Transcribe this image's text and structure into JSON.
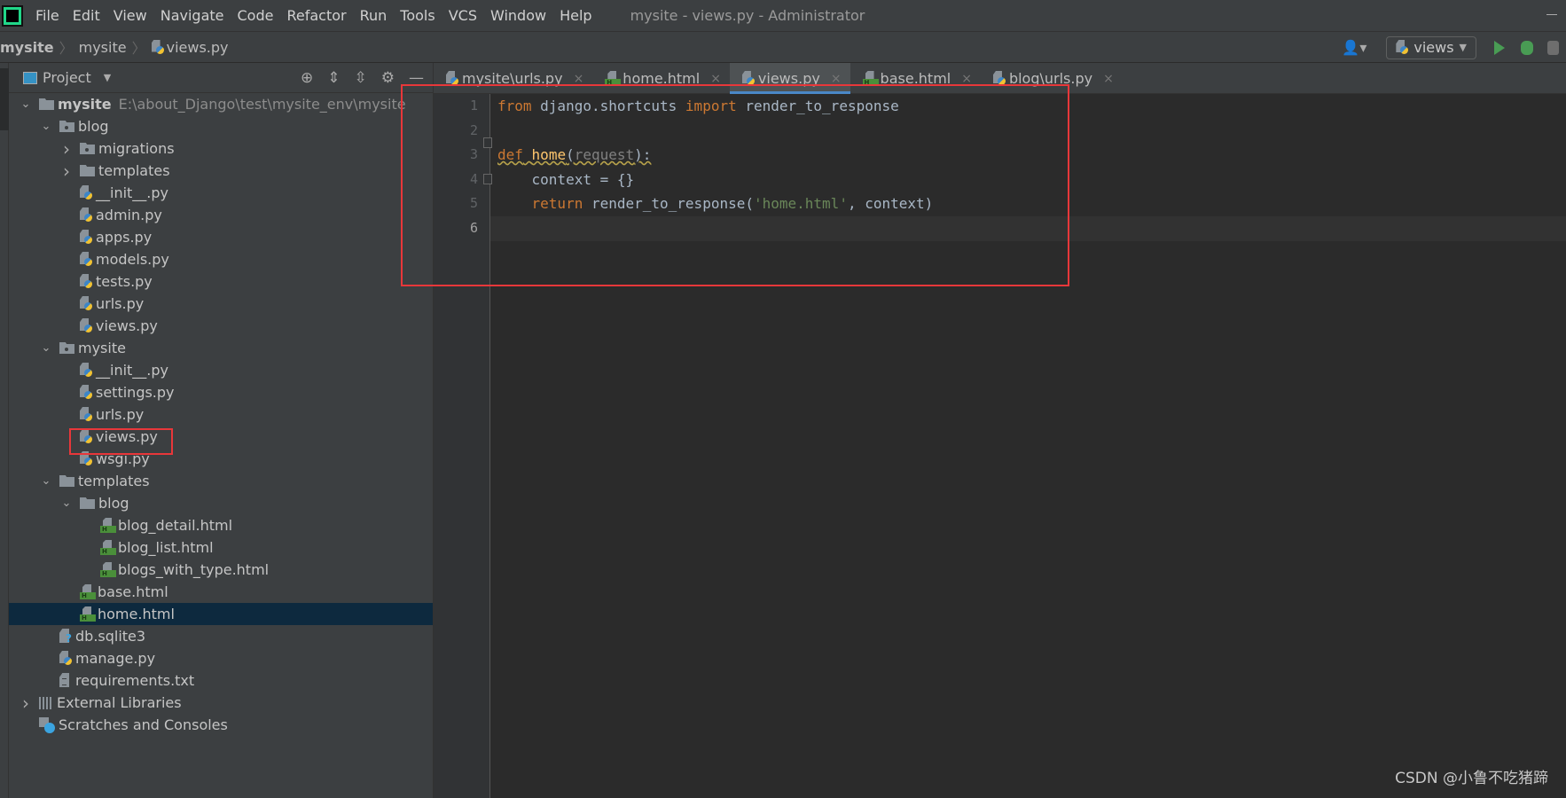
{
  "menubar": {
    "items": [
      "File",
      "Edit",
      "View",
      "Navigate",
      "Code",
      "Refactor",
      "Run",
      "Tools",
      "VCS",
      "Window",
      "Help"
    ],
    "window_title": "mysite - views.py - Administrator"
  },
  "breadcrumb": {
    "items": [
      "mysite",
      "mysite",
      "views.py"
    ]
  },
  "run_config": {
    "label": "views"
  },
  "project_panel": {
    "title": "Project"
  },
  "tree": [
    {
      "label": "mysite",
      "hint": "E:\\about_Django\\test\\mysite_env\\mysite",
      "depth": 0,
      "icon": "folder",
      "arrow": "down",
      "bold": true
    },
    {
      "label": "blog",
      "depth": 1,
      "icon": "folder-module",
      "arrow": "down"
    },
    {
      "label": "migrations",
      "depth": 2,
      "icon": "folder-module",
      "arrow": "right"
    },
    {
      "label": "templates",
      "depth": 2,
      "icon": "folder",
      "arrow": "right"
    },
    {
      "label": "__init__.py",
      "depth": 2,
      "icon": "python-file"
    },
    {
      "label": "admin.py",
      "depth": 2,
      "icon": "python-file"
    },
    {
      "label": "apps.py",
      "depth": 2,
      "icon": "python-file"
    },
    {
      "label": "models.py",
      "depth": 2,
      "icon": "python-file"
    },
    {
      "label": "tests.py",
      "depth": 2,
      "icon": "python-file"
    },
    {
      "label": "urls.py",
      "depth": 2,
      "icon": "python-file"
    },
    {
      "label": "views.py",
      "depth": 2,
      "icon": "python-file"
    },
    {
      "label": "mysite",
      "depth": 1,
      "icon": "folder-module",
      "arrow": "down"
    },
    {
      "label": "__init__.py",
      "depth": 2,
      "icon": "python-file"
    },
    {
      "label": "settings.py",
      "depth": 2,
      "icon": "python-file"
    },
    {
      "label": "urls.py",
      "depth": 2,
      "icon": "python-file"
    },
    {
      "label": "views.py",
      "depth": 2,
      "icon": "python-file",
      "highlighted": true
    },
    {
      "label": "wsgi.py",
      "depth": 2,
      "icon": "python-file"
    },
    {
      "label": "templates",
      "depth": 1,
      "icon": "folder",
      "arrow": "down"
    },
    {
      "label": "blog",
      "depth": 2,
      "icon": "folder",
      "arrow": "down"
    },
    {
      "label": "blog_detail.html",
      "depth": 3,
      "icon": "html-file"
    },
    {
      "label": "blog_list.html",
      "depth": 3,
      "icon": "html-file"
    },
    {
      "label": "blogs_with_type.html",
      "depth": 3,
      "icon": "html-file"
    },
    {
      "label": "base.html",
      "depth": 2,
      "icon": "html-file"
    },
    {
      "label": "home.html",
      "depth": 2,
      "icon": "html-file",
      "selected": true
    },
    {
      "label": "db.sqlite3",
      "depth": 1,
      "icon": "unknown-file"
    },
    {
      "label": "manage.py",
      "depth": 1,
      "icon": "python-file"
    },
    {
      "label": "requirements.txt",
      "depth": 1,
      "icon": "text-file"
    },
    {
      "label": "External Libraries",
      "depth": 0,
      "icon": "libraries",
      "arrow": "right"
    },
    {
      "label": "Scratches and Consoles",
      "depth": 0,
      "icon": "scratches"
    }
  ],
  "tabs": [
    {
      "label": "mysite\\urls.py",
      "icon": "python-file"
    },
    {
      "label": "home.html",
      "icon": "html-file"
    },
    {
      "label": "views.py",
      "icon": "python-file",
      "active": true
    },
    {
      "label": "base.html",
      "icon": "html-file"
    },
    {
      "label": "blog\\urls.py",
      "icon": "python-file"
    }
  ],
  "editor": {
    "current_line": 6,
    "lines": [
      [
        {
          "t": "from",
          "c": "kw"
        },
        {
          "t": " django.shortcuts "
        },
        {
          "t": "import",
          "c": "kw"
        },
        {
          "t": " render_to_response"
        }
      ],
      [],
      [
        {
          "t": "def",
          "c": "kw warn"
        },
        {
          "t": " ",
          "c": "warn"
        },
        {
          "t": "home",
          "c": "fn warn"
        },
        {
          "t": "(",
          "c": "warn"
        },
        {
          "t": "request",
          "c": "param warn"
        },
        {
          "t": "):",
          "c": "warn"
        }
      ],
      [
        {
          "t": "    context = {}"
        }
      ],
      [
        {
          "t": "    "
        },
        {
          "t": "return",
          "c": "kw"
        },
        {
          "t": " render_to_response("
        },
        {
          "t": "'home.html'",
          "c": "str"
        },
        {
          "t": ", context)"
        }
      ],
      []
    ]
  },
  "watermark": "CSDN @小鲁不吃猪蹄",
  "colors": {
    "annotation_box": "#e8373a",
    "keyword": "#cc7832",
    "function": "#ffc66d",
    "string": "#6a8759",
    "selection": "#0d293e",
    "active_tab_underline": "#4a88c7"
  }
}
